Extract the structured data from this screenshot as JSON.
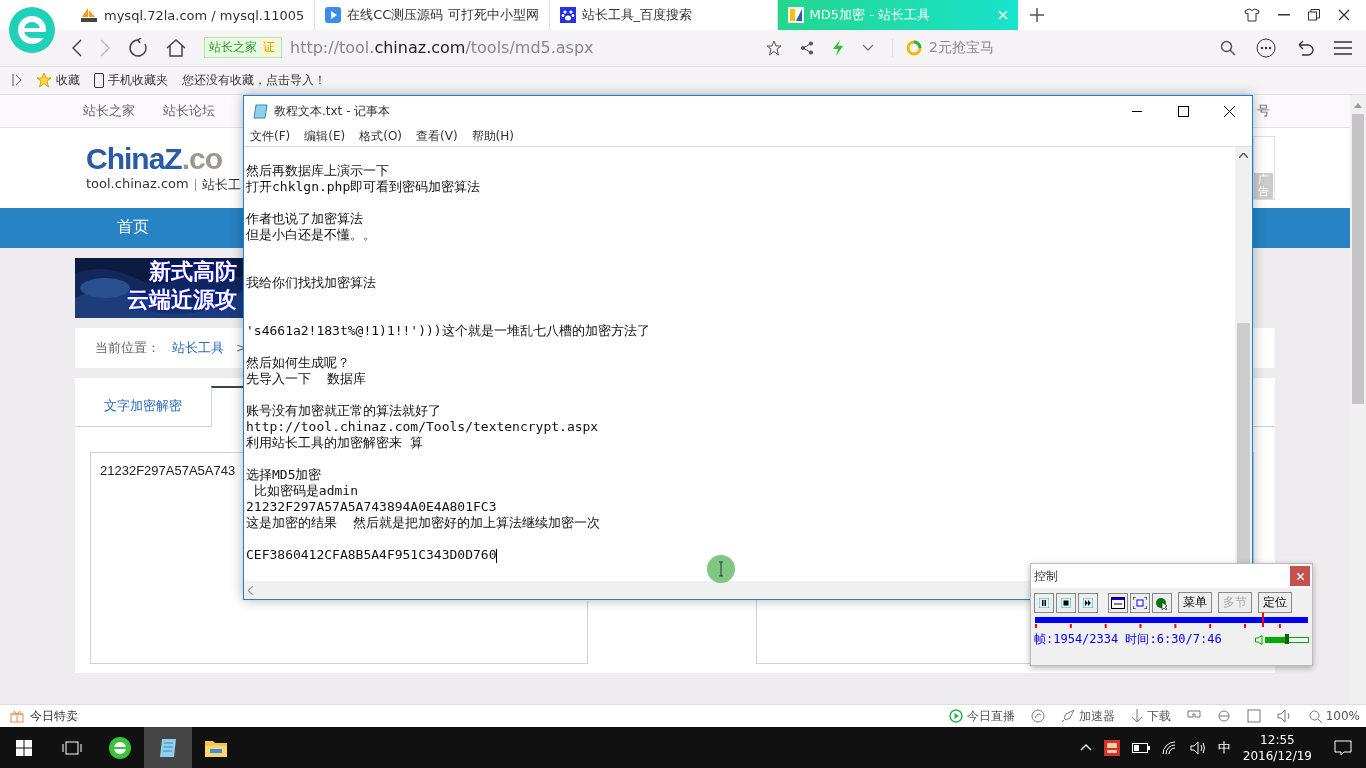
{
  "browser": {
    "tabs": [
      {
        "title": "mysql.72la.com / mysql.11005",
        "selected": false,
        "kind": "pma"
      },
      {
        "title": "在线CC测压源码 可打死中小型网",
        "selected": false,
        "kind": "play"
      },
      {
        "title": "站长工具_百度搜索",
        "selected": false,
        "kind": "paw"
      },
      {
        "title": "MD5加密 - 站长工具",
        "selected": true,
        "kind": "site"
      }
    ],
    "site_badge": "站长之家",
    "cert_badge": "证",
    "url": {
      "start": "http://tool.",
      "domain": "chinaz.com",
      "path": "/tools/md5.aspx"
    },
    "search_placeholder": "2元抢宝马"
  },
  "bookmarks": {
    "favorites": "收藏",
    "mobile": "手机收藏夹",
    "hint": "您还没有收藏，点击导入！"
  },
  "page": {
    "top_nav": [
      "站长之家",
      "站长论坛"
    ],
    "account": "号",
    "logo": {
      "text": "China",
      "mark": "Z",
      "suffix": ".co"
    },
    "domain": "tool.chinaz.com",
    "section": "站长工",
    "ad_label": "广告",
    "home": "首页",
    "banner_lines": [
      "新式高防",
      "云端近源攻"
    ],
    "breadcrumb": {
      "label": "当前位置：",
      "link": "站长工具",
      "separator": ">"
    },
    "tool_tabs": [
      {
        "label": "文字加密解密",
        "selected": false
      },
      {
        "selected": true
      }
    ],
    "input_value": "21232F297A57A5A743"
  },
  "notepad": {
    "title": "教程文本.txt - 记事本",
    "menu": [
      "文件(F)",
      "编辑(E)",
      "格式(O)",
      "查看(V)",
      "帮助(H)"
    ],
    "paragraphs": [
      {
        "kind": "near",
        "lines": [
          "然后再数据库上演示一下",
          "打开chklgn.php即可看到密码加密算法"
        ]
      },
      {
        "kind": "near",
        "lines": [
          "作者也说了加密算法",
          "但是小白还是不懂。。"
        ]
      },
      {
        "kind": "far",
        "lines": [
          "我给你们找找加密算法"
        ]
      },
      {
        "kind": "far",
        "lines": [
          "'s4661a2!183t%@!1)1!!')))这个就是一堆乱七八槽的加密方法了"
        ]
      },
      {
        "kind": "near",
        "lines": [
          "然后如何生成呢？",
          "先导入一下  数据库"
        ]
      },
      {
        "kind": "near",
        "lines": [
          "账号没有加密就正常的算法就好了",
          "http://tool.chinaz.com/Tools/textencrypt.aspx",
          "利用站长工具的加密解密来 算"
        ]
      },
      {
        "kind": "near",
        "lines": [
          "选择MD5加密",
          " 比如密码是admin",
          "21232F297A57A5A743894A0E4A801FC3",
          "这是加密的结果  然后就是把加密好的加上算法继续加密一次"
        ]
      },
      {
        "kind": "near",
        "lines": [
          "CEF3860412CFA8B5A4F951C343D0D760"
        ]
      }
    ]
  },
  "player": {
    "title": "控制",
    "buttons": [
      {
        "label": "菜单",
        "disabled": false
      },
      {
        "label": "多节",
        "disabled": true
      },
      {
        "label": "定位",
        "disabled": false
      }
    ],
    "progress": {
      "level": 0.836
    },
    "status": "帧:1954/2334 时间:6:30/7:46",
    "volume": {
      "level": 0.5
    }
  },
  "status_bar": {
    "deals": "今日特卖",
    "live": "今日直播",
    "accelerator": "加速器",
    "download": "下载",
    "zoom": "100%"
  },
  "taskbar": {
    "ime": "中",
    "time": "12:55",
    "date": "2016/12/19"
  }
}
